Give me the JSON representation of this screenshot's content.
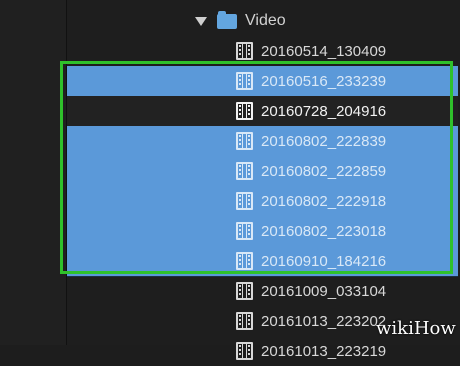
{
  "folder": {
    "name": "Video",
    "expand_icon": "triangle-down-icon",
    "icon": "folder-icon",
    "color": "#63a6e0"
  },
  "files": [
    {
      "name": "20160514_130409",
      "state": "normal"
    },
    {
      "name": "20160516_233239",
      "state": "selected"
    },
    {
      "name": "20160728_204916",
      "state": "dark"
    },
    {
      "name": "20160802_222839",
      "state": "selected"
    },
    {
      "name": "20160802_222859",
      "state": "selected"
    },
    {
      "name": "20160802_222918",
      "state": "selected"
    },
    {
      "name": "20160802_223018",
      "state": "selected"
    },
    {
      "name": "20160910_184216",
      "state": "selected"
    },
    {
      "name": "20161009_033104",
      "state": "normal"
    },
    {
      "name": "20161013_223202",
      "state": "normal"
    },
    {
      "name": "20161013_223219",
      "state": "normal"
    }
  ],
  "file_icon": "film-strip-icon",
  "colors": {
    "selection": "#5b99d9",
    "highlight_box": "#2fc12b",
    "background": "#1e1e1e"
  },
  "watermark": "wikiHow"
}
